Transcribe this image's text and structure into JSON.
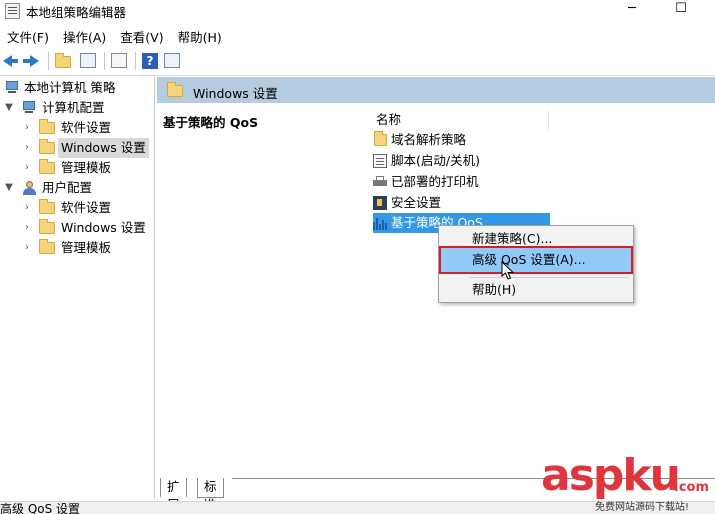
{
  "window": {
    "title": "本地组策略编辑器",
    "minimize": "─",
    "maximize": "☐"
  },
  "menu": [
    "文件(F)",
    "操作(A)",
    "查看(V)",
    "帮助(H)"
  ],
  "tree": {
    "root": "本地计算机 策略",
    "computer_config": "计算机配置",
    "computer_children": [
      "软件设置",
      "Windows 设置",
      "管理模板"
    ],
    "user_config": "用户配置",
    "user_children": [
      "软件设置",
      "Windows 设置",
      "管理模板"
    ]
  },
  "right": {
    "header": "Windows 设置",
    "description_title": "基于策略的 QoS",
    "column_name": "名称",
    "items": [
      "域名解析策略",
      "脚本(启动/关机)",
      "已部署的打印机",
      "安全设置",
      "基于策略的 QoS"
    ]
  },
  "context_menu": [
    "新建策略(C)...",
    "高级 QoS 设置(A)...",
    "帮助(H)"
  ],
  "tabs": [
    "扩展",
    "标准"
  ],
  "status": "高级 QoS 设置",
  "watermark": {
    "main": "aspku",
    "suffix": ".com",
    "sub": "免费网站源码下载站!"
  },
  "colors": {
    "header_bg": "#b4cbe0",
    "selection": "#3399e6",
    "menu_highlight": "#91c9f7",
    "highlight_border": "#d61e2a",
    "watermark": "#e0353d"
  }
}
